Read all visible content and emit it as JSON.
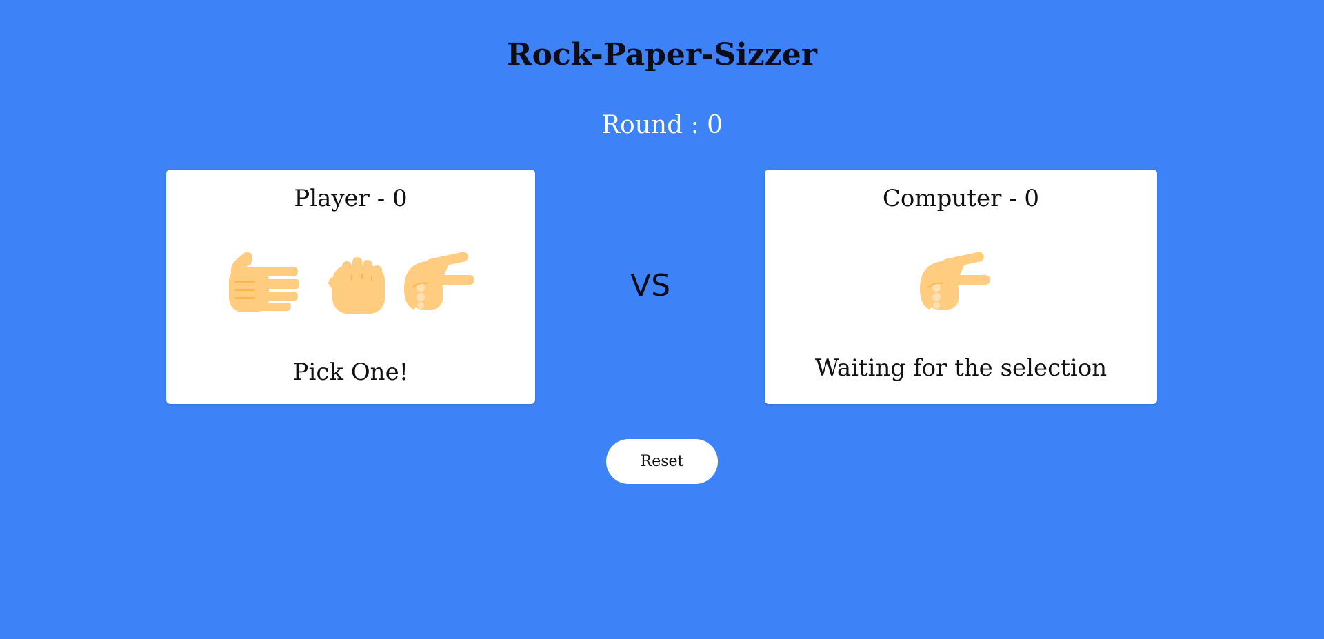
{
  "header": {
    "title": "Rock-Paper-Sizzer",
    "round_label": "Round : 0"
  },
  "player": {
    "title": "Player - 0",
    "prompt": "Pick One!",
    "choices": [
      "paper",
      "rock",
      "scissors"
    ]
  },
  "versus": {
    "label": "VS"
  },
  "computer": {
    "title": "Computer - 0",
    "status": "Waiting for the selection",
    "shown_choice": "scissors"
  },
  "controls": {
    "reset_label": "Reset"
  },
  "colors": {
    "background": "#3d82f6",
    "card": "#ffffff",
    "skin": "#ffcc80",
    "skin_shade": "#ffb74d"
  }
}
